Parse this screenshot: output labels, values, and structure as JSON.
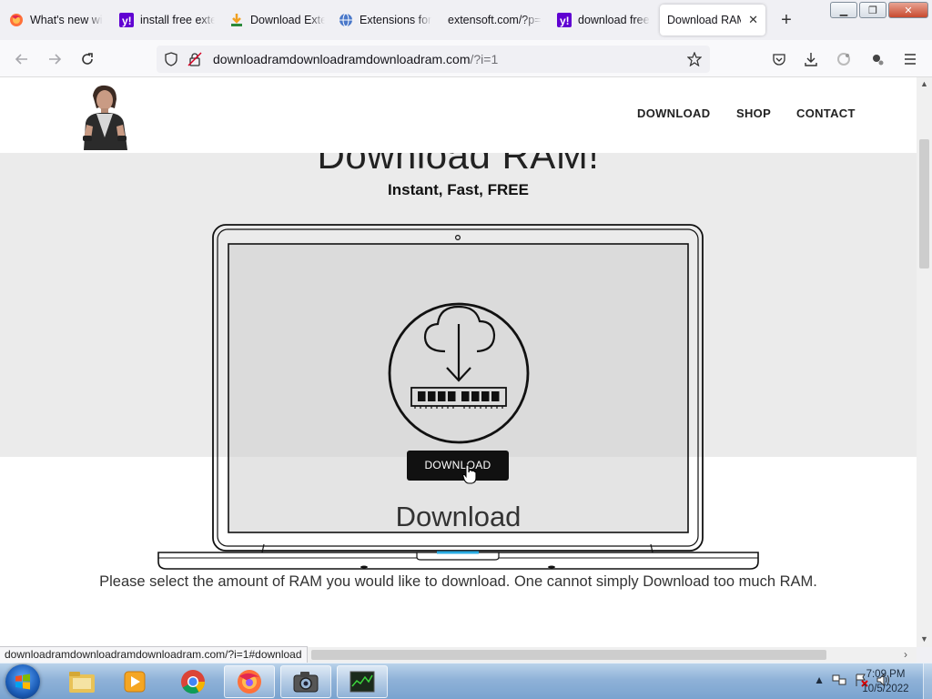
{
  "browser": {
    "tabs": [
      {
        "title": "What's new wi",
        "icon": "firefox-icon"
      },
      {
        "title": "install free exte",
        "icon": "yahoo-icon"
      },
      {
        "title": "Download Exte",
        "icon": "download-site-icon"
      },
      {
        "title": "Extensions for",
        "icon": "globe-icon"
      },
      {
        "title": "extensoft.com/?p=",
        "icon": ""
      },
      {
        "title": "download free",
        "icon": "yahoo-icon"
      },
      {
        "title": "Download RAM",
        "icon": "",
        "active": true
      }
    ],
    "url_host": "downloadramdownloadramdownloadram.com",
    "url_path": "/?i=1",
    "status_text": "downloadramdownloadramdownloadram.com/?i=1#download"
  },
  "site": {
    "nav": [
      "DOWNLOAD",
      "SHOP",
      "CONTACT"
    ],
    "hero_title": "Download RAM!",
    "hero_subtitle": "Instant, Fast, FREE",
    "download_button": "DOWNLOAD",
    "download_heading": "Download",
    "download_description": "Please select the amount of RAM you would like to download. One cannot simply Download too much RAM."
  },
  "taskbar": {
    "items": [
      "explorer-icon",
      "media-player-icon",
      "chrome-icon",
      "firefox-icon",
      "camera-app-icon",
      "task-manager-icon"
    ],
    "time": "7:09 PM",
    "date": "10/5/2022"
  },
  "colors": {
    "accent_yahoo": "#6001d2",
    "button_bg": "#111111",
    "hero_bg": "#ebebeb",
    "trackpad_accent": "#29abe2"
  }
}
